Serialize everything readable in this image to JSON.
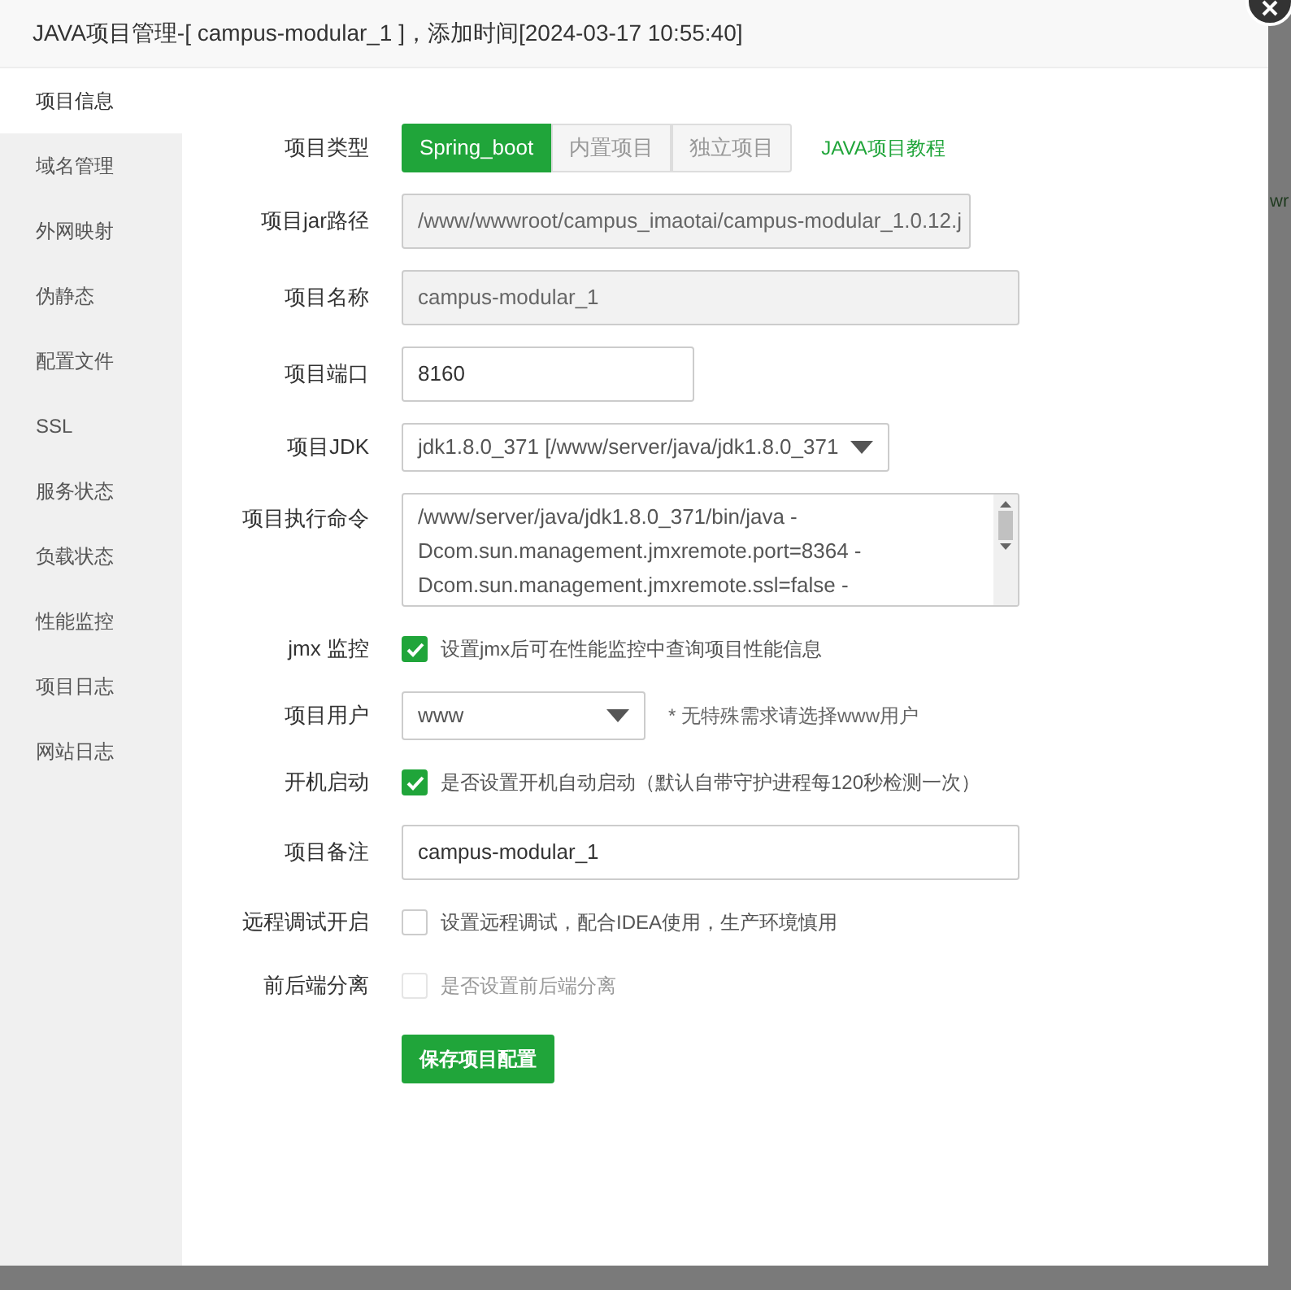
{
  "window": {
    "title": "JAVA项目管理-[ campus-modular_1 ]，添加时间[2024-03-17 10:55:40]"
  },
  "background_text": "wr",
  "sidebar": {
    "items": [
      {
        "label": "项目信息",
        "selected": true
      },
      {
        "label": "域名管理",
        "selected": false
      },
      {
        "label": "外网映射",
        "selected": false
      },
      {
        "label": "伪静态",
        "selected": false
      },
      {
        "label": "配置文件",
        "selected": false
      },
      {
        "label": "SSL",
        "selected": false
      },
      {
        "label": "服务状态",
        "selected": false
      },
      {
        "label": "负载状态",
        "selected": false
      },
      {
        "label": "性能监控",
        "selected": false
      },
      {
        "label": "项目日志",
        "selected": false
      },
      {
        "label": "网站日志",
        "selected": false
      }
    ]
  },
  "form": {
    "type": {
      "label": "项目类型",
      "options": [
        {
          "label": "Spring_boot",
          "selected": true
        },
        {
          "label": "内置项目",
          "selected": false
        },
        {
          "label": "独立项目",
          "selected": false
        }
      ],
      "link": "JAVA项目教程"
    },
    "fields": [
      {
        "kind": "input",
        "label": "项目jar路径",
        "value": "/www/wwwroot/campus_imaotai/campus-modular_1.0.12.j",
        "readonly": true
      },
      {
        "kind": "input",
        "label": "项目名称",
        "value": "campus-modular_1",
        "readonly": true
      },
      {
        "kind": "input",
        "label": "项目端口",
        "value": "8160",
        "readonly": false
      },
      {
        "kind": "select",
        "label": "项目JDK",
        "value": "jdk1.8.0_371 [/www/server/java/jdk1.8.0_371"
      },
      {
        "kind": "textarea",
        "label": "项目执行命令",
        "lines": [
          "/www/server/java/jdk1.8.0_371/bin/java -",
          "Dcom.sun.management.jmxremote.port=8364 -",
          "Dcom.sun.management.jmxremote.ssl=false -"
        ]
      },
      {
        "kind": "checkbox",
        "label": "jmx 监控",
        "checked": true,
        "disabled": false,
        "text": "设置jmx后可在性能监控中查询项目性能信息"
      },
      {
        "kind": "select-short",
        "label": "项目用户",
        "value": "www",
        "hint": "* 无特殊需求请选择www用户"
      },
      {
        "kind": "checkbox",
        "label": "开机启动",
        "checked": true,
        "disabled": false,
        "text": "是否设置开机自动启动（默认自带守护进程每120秒检测一次）"
      },
      {
        "kind": "input",
        "label": "项目备注",
        "value": "campus-modular_1",
        "readonly": false
      },
      {
        "kind": "checkbox",
        "label": "远程调试开启",
        "checked": false,
        "disabled": false,
        "text": "设置远程调试，配合IDEA使用，生产环境慎用"
      },
      {
        "kind": "checkbox",
        "label": "前后端分离",
        "checked": false,
        "disabled": true,
        "text": "是否设置前后端分离"
      }
    ],
    "save_button": "保存项目配置"
  }
}
